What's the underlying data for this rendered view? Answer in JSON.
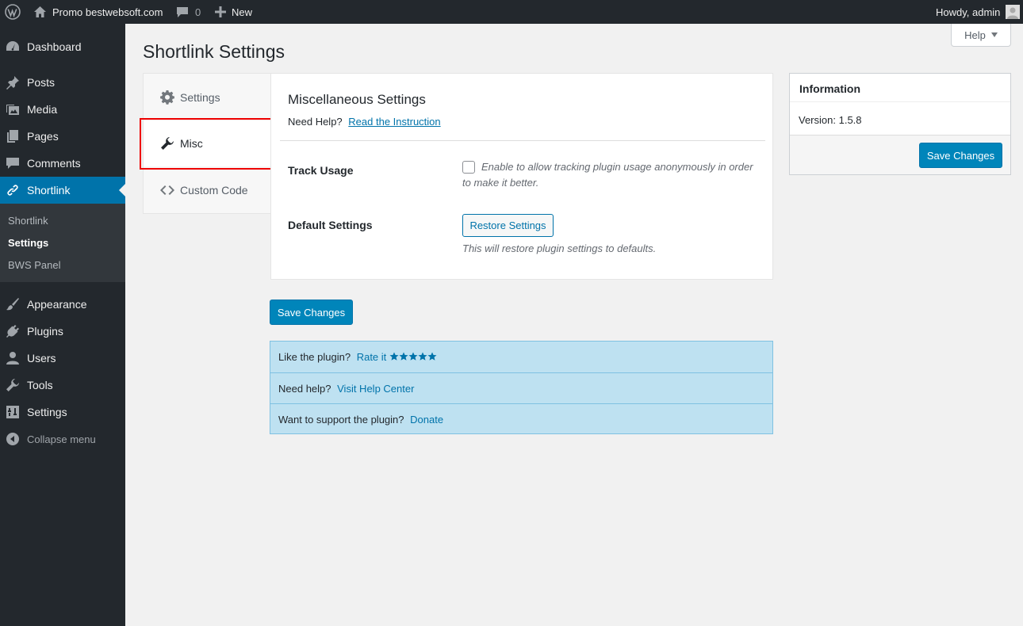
{
  "admin_bar": {
    "site_name": "Promo bestwebsoft.com",
    "comments_count": "0",
    "new_label": "New",
    "greeting": "Howdy, admin"
  },
  "sidebar": {
    "items": [
      {
        "label": "Dashboard",
        "icon": "dashboard-icon"
      },
      {
        "label": "Posts",
        "icon": "pin-icon"
      },
      {
        "label": "Media",
        "icon": "media-icon"
      },
      {
        "label": "Pages",
        "icon": "pages-icon"
      },
      {
        "label": "Comments",
        "icon": "comment-icon"
      },
      {
        "label": "Shortlink",
        "icon": "link-icon"
      },
      {
        "label": "Appearance",
        "icon": "brush-icon"
      },
      {
        "label": "Plugins",
        "icon": "plugin-icon"
      },
      {
        "label": "Users",
        "icon": "user-icon"
      },
      {
        "label": "Tools",
        "icon": "wrench-icon"
      },
      {
        "label": "Settings",
        "icon": "sliders-icon"
      }
    ],
    "submenu": [
      "Shortlink",
      "Settings",
      "BWS Panel"
    ],
    "collapse_label": "Collapse menu"
  },
  "help_tab": "Help",
  "page_title": "Shortlink Settings",
  "tabs": [
    {
      "label": "Settings",
      "icon": "gear-icon"
    },
    {
      "label": "Misc",
      "icon": "wrench-icon"
    },
    {
      "label": "Custom Code",
      "icon": "code-icon"
    }
  ],
  "misc": {
    "title": "Miscellaneous Settings",
    "need_help": "Need Help?",
    "instruction_link": "Read the Instruction",
    "track_usage_label": "Track Usage",
    "track_usage_desc": "Enable to allow tracking plugin usage anonymously in order to make it better.",
    "default_settings_label": "Default Settings",
    "restore_button": "Restore Settings",
    "restore_desc": "This will restore plugin settings to defaults."
  },
  "save_button": "Save Changes",
  "info_box": {
    "title": "Information",
    "version_label": "Version:",
    "version_value": "1.5.8",
    "save_button": "Save Changes"
  },
  "promo": {
    "like_text": "Like the plugin?",
    "rate_link": "Rate it",
    "help_text": "Need help?",
    "help_link": "Visit Help Center",
    "support_text": "Want to support the plugin?",
    "donate_link": "Donate"
  },
  "colors": {
    "accent": "#0073aa",
    "sidebar_bg": "#23282d",
    "highlight_border": "#ee0000",
    "promo_bg": "#bee1f1"
  }
}
